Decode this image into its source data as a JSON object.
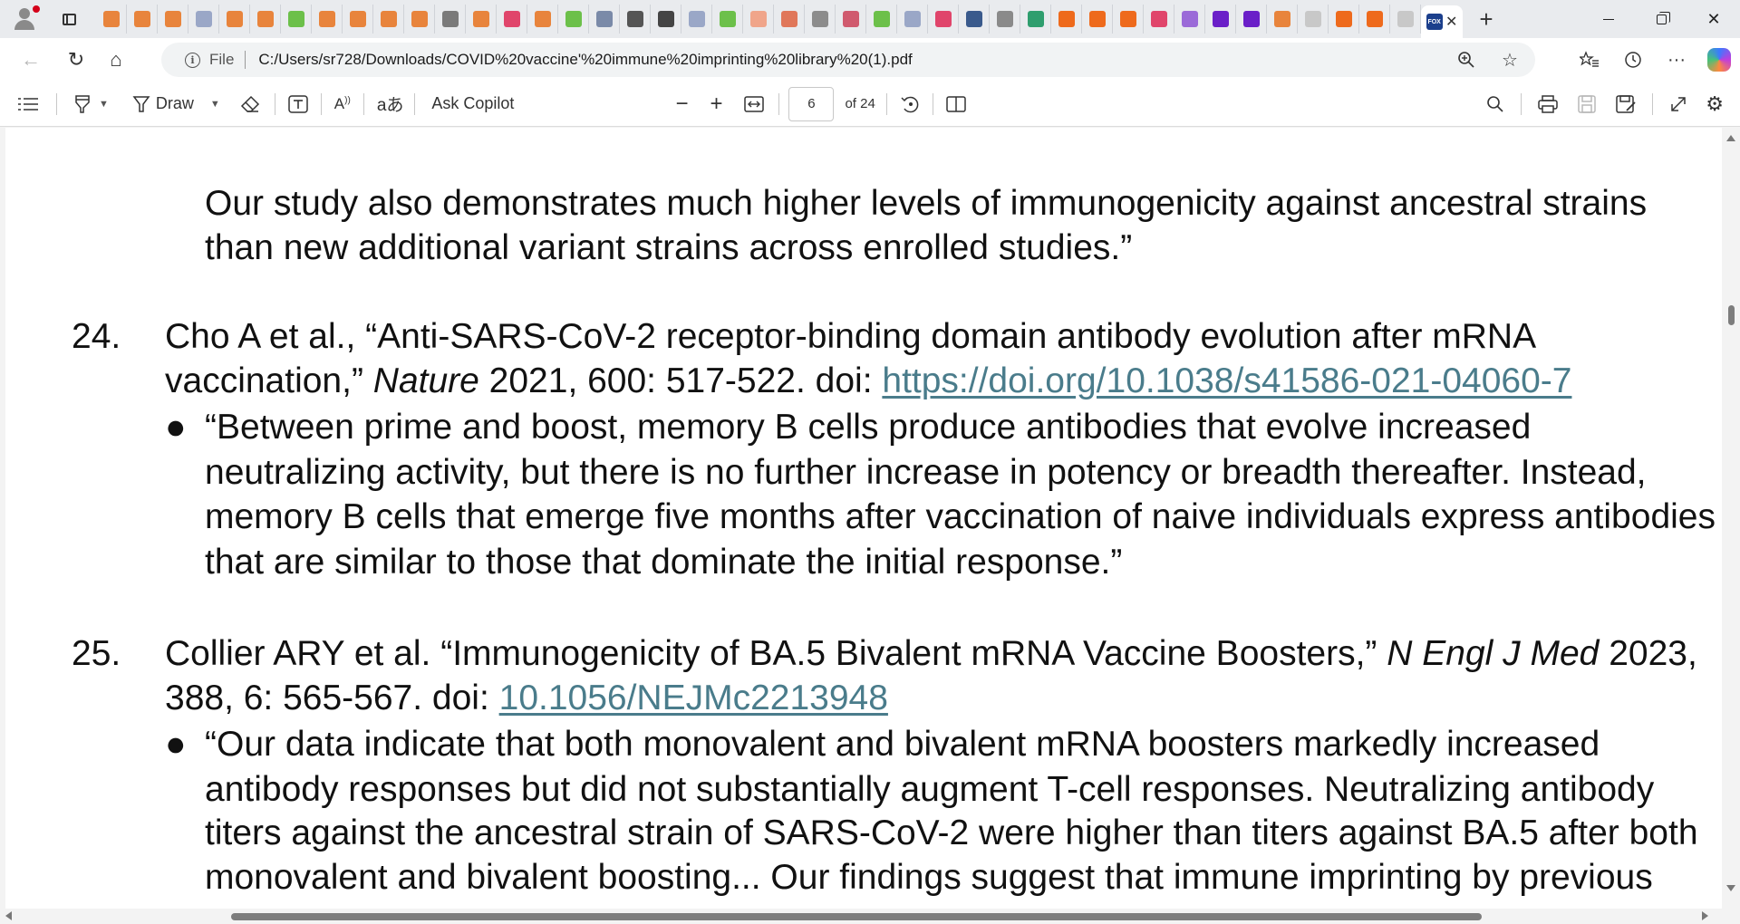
{
  "window": {
    "tab_favicons": [
      {
        "icon": "bookmark-icon",
        "color": "#e8843c"
      },
      {
        "icon": "bookmark-icon",
        "color": "#e8843c"
      },
      {
        "icon": "bookmark-icon",
        "color": "#e8843c"
      },
      {
        "icon": "web-icon",
        "color": "#9aa7c7"
      },
      {
        "icon": "bookmark-icon",
        "color": "#e8843c"
      },
      {
        "icon": "bookmark-icon",
        "color": "#e8843c"
      },
      {
        "icon": "play-icon",
        "color": "#6cc04a"
      },
      {
        "icon": "bookmark-icon",
        "color": "#e8843c"
      },
      {
        "icon": "bookmark-icon",
        "color": "#e8843c"
      },
      {
        "icon": "bookmark-icon",
        "color": "#e8843c"
      },
      {
        "icon": "bookmark-icon",
        "color": "#e8843c"
      },
      {
        "icon": "mk-icon",
        "color": "#7a7a7a"
      },
      {
        "icon": "bookmark-icon",
        "color": "#e8843c"
      },
      {
        "icon": "video-icon",
        "color": "#e0456b"
      },
      {
        "icon": "bookmark-icon",
        "color": "#e8843c"
      },
      {
        "icon": "play-icon",
        "color": "#6cc04a"
      },
      {
        "icon": "search-icon",
        "color": "#7a8aa8"
      },
      {
        "icon": "slash-icon",
        "color": "#555555"
      },
      {
        "icon": "diamond-icon",
        "color": "#444444"
      },
      {
        "icon": "web-icon",
        "color": "#9aa7c7"
      },
      {
        "icon": "play-icon",
        "color": "#6cc04a"
      },
      {
        "icon": "b-icon",
        "color": "#f0a58a"
      },
      {
        "icon": "e-icon",
        "color": "#e0775a"
      },
      {
        "icon": "check-icon",
        "color": "#8c8c8c"
      },
      {
        "icon": "f-icon",
        "color": "#d05a6e"
      },
      {
        "icon": "play-icon",
        "color": "#6cc04a"
      },
      {
        "icon": "web-icon",
        "color": "#9aa7c7"
      },
      {
        "icon": "video-icon",
        "color": "#e0456b"
      },
      {
        "icon": "news-icon",
        "color": "#3a5a8c"
      },
      {
        "icon": "gp-icon",
        "color": "#8a8a8a"
      },
      {
        "icon": "owl-icon",
        "color": "#2f9e6e"
      },
      {
        "icon": "bookmark-icon",
        "color": "#ee6a1c"
      },
      {
        "icon": "bookmark-icon",
        "color": "#ee6a1c"
      },
      {
        "icon": "bookmark-icon",
        "color": "#ee6a1c"
      },
      {
        "icon": "video-icon",
        "color": "#e0456b"
      },
      {
        "icon": "yahoo-icon",
        "color": "#9b6ad8"
      },
      {
        "icon": "yahoo-icon",
        "color": "#6a1fc8"
      },
      {
        "icon": "mail-icon",
        "color": "#6a1fc8"
      },
      {
        "icon": "bookmark-icon",
        "color": "#e8843c"
      },
      {
        "icon": "puzzle-icon",
        "color": "#c8c8c8"
      },
      {
        "icon": "bookmark-icon",
        "color": "#ee6a1c"
      },
      {
        "icon": "bookmark-icon",
        "color": "#ee6a1c"
      },
      {
        "icon": "ze-icon",
        "color": "#c8c8c8"
      }
    ],
    "active_tab_icon": "fox-news-icon",
    "active_tab_icon_color": "#1b3f8c"
  },
  "address_bar": {
    "scheme_label": "File",
    "url": "C:/Users/sr728/Downloads/COVID%20vaccine'%20immune%20imprinting%20library%20(1).pdf"
  },
  "pdf_toolbar": {
    "draw_label": "Draw",
    "ask_copilot_label": "Ask Copilot",
    "current_page": "6",
    "page_of": "of 24"
  },
  "document": {
    "lead_lines": [
      "Our study also demonstrates much higher levels of immunogenicity against ancestral strains",
      "than new additional variant strains across enrolled studies.”"
    ],
    "references": [
      {
        "number": "24.",
        "line1": "Cho A et al., “Anti-SARS-CoV-2 receptor-binding domain antibody evolution after mRNA",
        "line2_pre": "vaccination,” ",
        "line2_journal": "Nature",
        "line2_post": " 2021, 600: 517-522. doi: ",
        "link": "https://doi.org/10.1038/s41586-021-04060-7",
        "bullet_lines": [
          "“Between prime and boost, memory B cells produce antibodies that evolve increased",
          "neutralizing activity, but there is no further increase in potency or breadth thereafter. Instead,",
          "memory B cells that emerge five months after vaccination of naive individuals express antibodies",
          "that are similar to those that dominate the initial response.”"
        ]
      },
      {
        "number": "25.",
        "line1_pre": "Collier ARY et al. “Immunogenicity of BA.5 Bivalent mRNA Vaccine Boosters,” ",
        "line1_journal": "N Engl J Med",
        "line1_post": " 2023,",
        "line2_pre": "388, 6: 565-567. doi: ",
        "link": "10.1056/NEJMc2213948",
        "bullet_lines": [
          "“Our data indicate that both monovalent and bivalent mRNA boosters markedly increased",
          "antibody responses but did not substantially augment T-cell responses. Neutralizing antibody",
          "titers against the ancestral strain of SARS-CoV-2 were higher than titers against BA.5 after both",
          "monovalent and bivalent boosting... Our findings suggest that immune imprinting by previous"
        ]
      }
    ],
    "link_color": "#4a7c8b",
    "bullet_glyph": "●"
  }
}
